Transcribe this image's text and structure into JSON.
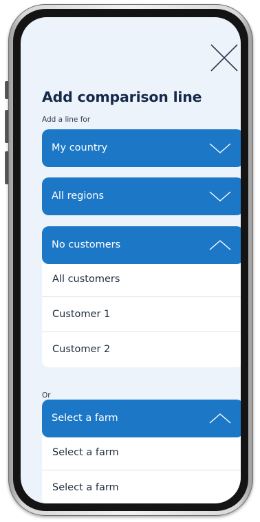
{
  "modal": {
    "title": "Add comparison line",
    "subtitle": "Add a line for",
    "or_label": "Or"
  },
  "dropdowns": [
    {
      "label": "My country",
      "state": "collapsed",
      "chevron": "chevron-down-icon"
    },
    {
      "label": "All regions",
      "state": "collapsed",
      "chevron": "chevron-down-icon"
    },
    {
      "label": "No customers",
      "state": "expanded",
      "chevron": "chevron-up-icon",
      "options": [
        "All customers",
        "Customer 1",
        "Customer 2"
      ]
    },
    {
      "label": "Select a farm",
      "state": "expanded",
      "chevron": "chevron-up-icon",
      "options": [
        "Select a farm",
        "Select a farm"
      ]
    }
  ],
  "icons": {
    "close": "close-icon"
  },
  "colors": {
    "accent": "#1c78c6",
    "screen_background": "#edf3fa",
    "title": "#152a4a",
    "option_text": "#1f2d3d"
  }
}
